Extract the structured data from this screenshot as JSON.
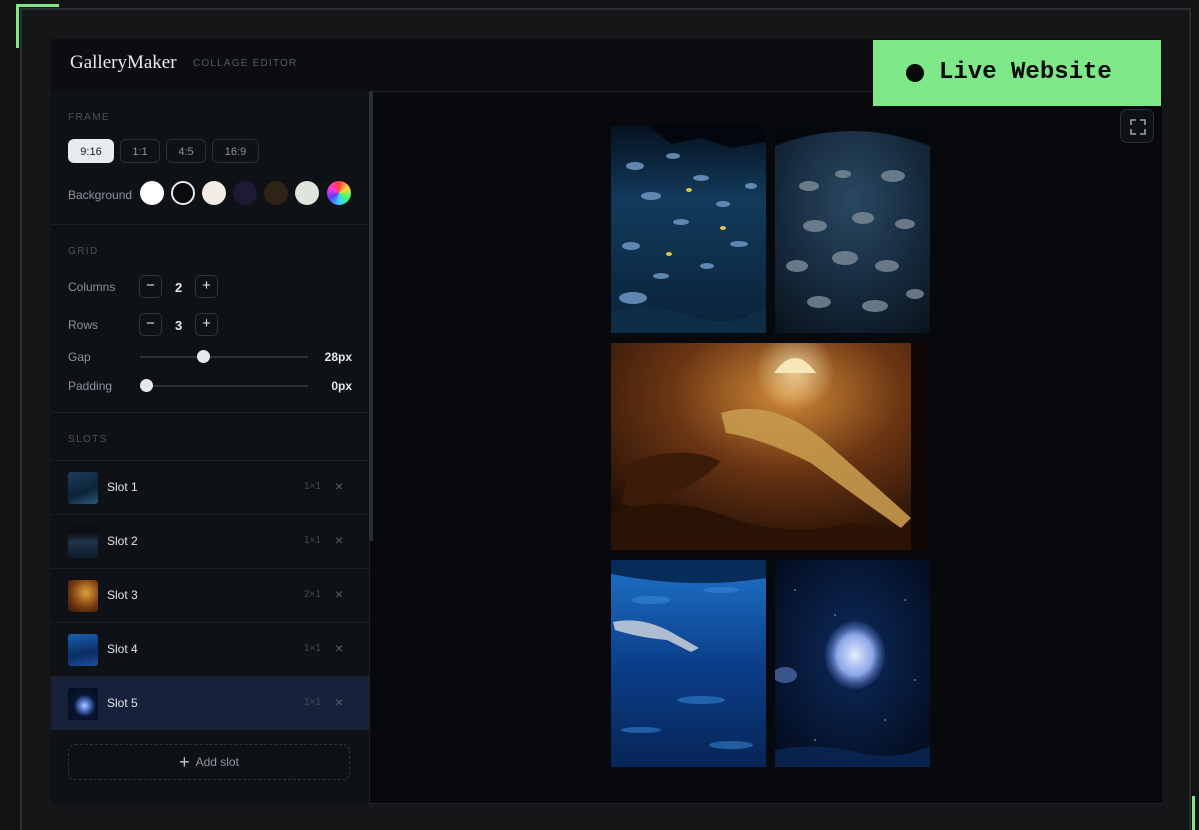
{
  "badge": {
    "label": "Live Website"
  },
  "header": {
    "brand": "GalleryMaker",
    "subtitle": "COLLAGE EDITOR"
  },
  "frame": {
    "section_label": "FRAME",
    "ratios": [
      "9:16",
      "1:1",
      "4:5",
      "16:9"
    ],
    "selected_ratio": "9:16",
    "background_label": "Background",
    "swatches": [
      "#ffffff",
      "#0b0b0d",
      "#f1ece4",
      "#1d1b33",
      "#2e2316",
      "#dde6db",
      "rainbow"
    ]
  },
  "grid": {
    "section_label": "GRID",
    "columns_label": "Columns",
    "columns_value": "2",
    "rows_label": "Rows",
    "rows_value": "3",
    "gap_label": "Gap",
    "gap_value": "28px",
    "gap_level": 0.37,
    "padding_label": "Padding",
    "padding_value": "0px",
    "padding_level": 0
  },
  "slots": {
    "section_label": "SLOTS",
    "items": [
      {
        "name": "Slot 1",
        "size": "1×1",
        "remove": "×"
      },
      {
        "name": "Slot 2",
        "size": "1×1",
        "remove": "×"
      },
      {
        "name": "Slot 3",
        "size": "2×1",
        "remove": "×"
      },
      {
        "name": "Slot 4",
        "size": "1×1",
        "remove": "×"
      },
      {
        "name": "Slot 5",
        "size": "1×1",
        "remove": "×"
      }
    ],
    "selected_index": 4,
    "add_label": "Add slot"
  },
  "icons": {
    "minus": "−",
    "plus": "+",
    "fullscreen": "fullscreen-icon"
  }
}
